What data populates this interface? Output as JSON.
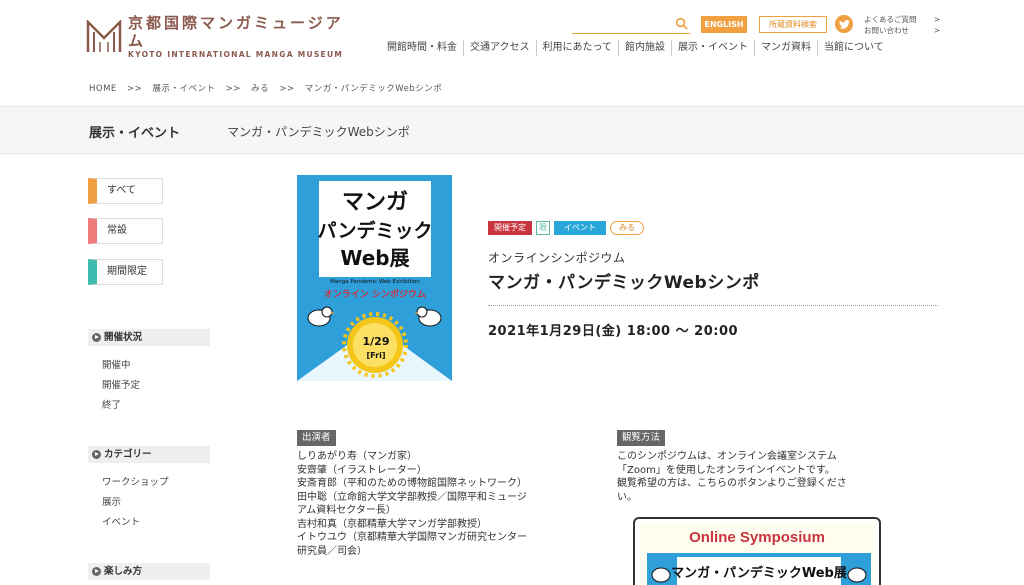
{
  "header": {
    "logo_jp": "京都国際マンガミュージアム",
    "logo_en": "KYOTO INTERNATIONAL MANGA MUSEUM",
    "english_label": "ENGLISH",
    "holdings_label": "所蔵資料検索",
    "faq_label": "よくあるご質問",
    "contact_label": "お問い合わせ",
    "nav": [
      "開館時間・料金",
      "交通アクセス",
      "利用にあたって",
      "館内施設",
      "展示・イベント",
      "マンガ資料",
      "当館について"
    ]
  },
  "breadcrumb": [
    "HOME",
    ">>",
    "展示・イベント",
    ">>",
    "みる",
    ">>",
    "マンガ・パンデミックWebシンポ"
  ],
  "titlebar": {
    "category": "展示・イベント",
    "name": "マンガ・パンデミックWebシンポ"
  },
  "sidebar": {
    "tabs": [
      {
        "label": "すべて",
        "color": "#f0a040"
      },
      {
        "label": "常設",
        "color": "#ee7a7a"
      },
      {
        "label": "期間限定",
        "color": "#3fbcb0"
      }
    ],
    "status": {
      "heading": "開催状況",
      "items": [
        "開催中",
        "開催予定",
        "終了"
      ]
    },
    "category": {
      "heading": "カテゴリー",
      "items": [
        "ワークショップ",
        "展示",
        "イベント"
      ]
    },
    "enjoy": {
      "heading": "楽しみ方"
    }
  },
  "poster": {
    "title_line1": "マンガ",
    "title_line2": "パンデミック",
    "title_line3": "Web展",
    "subtitle_en": "Manga Pandemic Web Exhibition",
    "subtitle_jp": "オンライン シンポジウム",
    "date_num": "1/29",
    "date_day": "[Fri]"
  },
  "event": {
    "tags": {
      "status": "開催予定",
      "pre": "限",
      "type": "イベント",
      "kind": "みる"
    },
    "subtitle": "オンラインシンポジウム",
    "title": "マンガ・パンデミックWebシンポ",
    "datetime": "2021年1月29日(金) 18:00 〜 20:00"
  },
  "performers": {
    "label": "出演者",
    "lines": [
      "しりあがり寿（マンガ家）",
      "安齋肇（イラストレーター）",
      "安斎育郎（平和のための博物館国際ネットワーク）",
      "田中聡（立命館大学文学部教授／国際平和ミュージ",
      "アム資料セクター長）",
      "吉村和真（京都精華大学マンガ学部教授）",
      "イトウユウ（京都精華大学国際マンガ研究センター",
      "研究員／司会）"
    ]
  },
  "viewing": {
    "label": "観覧方法",
    "lines": [
      "このシンポジウムは、オンライン会議室システム",
      "「Zoom」を使用したオンラインイベントです。",
      "観覧希望の方は、こちらのボタンよりご登録くださ",
      "い。"
    ],
    "banner_title": "Online Symposium",
    "banner_strip": "マンガ・パンデミックWeb展"
  },
  "colors": {
    "accent": "#f0a040",
    "brand": "#8a5a4e",
    "poster_blue": "#2e9fd9"
  }
}
